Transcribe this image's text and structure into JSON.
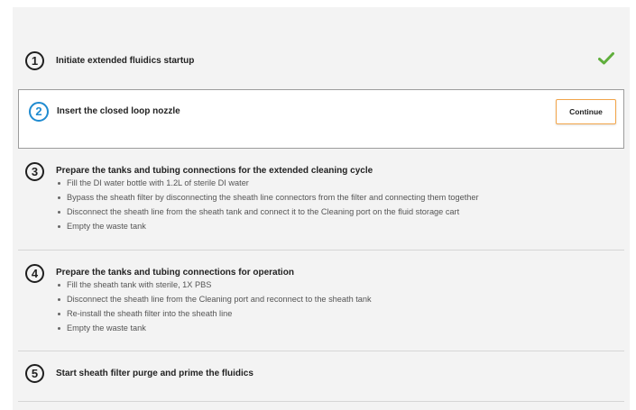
{
  "steps": [
    {
      "number": "1",
      "title": "Initiate extended fluidics startup",
      "status": "complete"
    },
    {
      "number": "2",
      "title": "Insert the closed loop nozzle",
      "status": "active",
      "button_label": "Continue"
    },
    {
      "number": "3",
      "title": "Prepare the tanks and tubing connections for the extended cleaning cycle",
      "bullets": [
        "Fill the DI water bottle with 1.2L of sterile DI water",
        "Bypass the sheath filter by disconnecting the sheath line connectors from the filter and connecting them together",
        "Disconnect the sheath line from the sheath tank and connect it to the Cleaning port on the fluid storage cart",
        "Empty the waste tank"
      ]
    },
    {
      "number": "4",
      "title": "Prepare the tanks and tubing connections for operation",
      "bullets": [
        "Fill the sheath tank with sterile, 1X PBS",
        "Disconnect the sheath line from the Cleaning port and reconnect to the sheath tank",
        "Re-install the sheath filter into the sheath line",
        "Empty the waste tank"
      ]
    },
    {
      "number": "5",
      "title": "Start sheath filter purge and prime the fluidics"
    }
  ],
  "colors": {
    "active_accent": "#1f8bd0",
    "complete_check": "#5fae3c",
    "button_border": "#f2a54a"
  },
  "icons": {
    "complete": "check-icon"
  }
}
